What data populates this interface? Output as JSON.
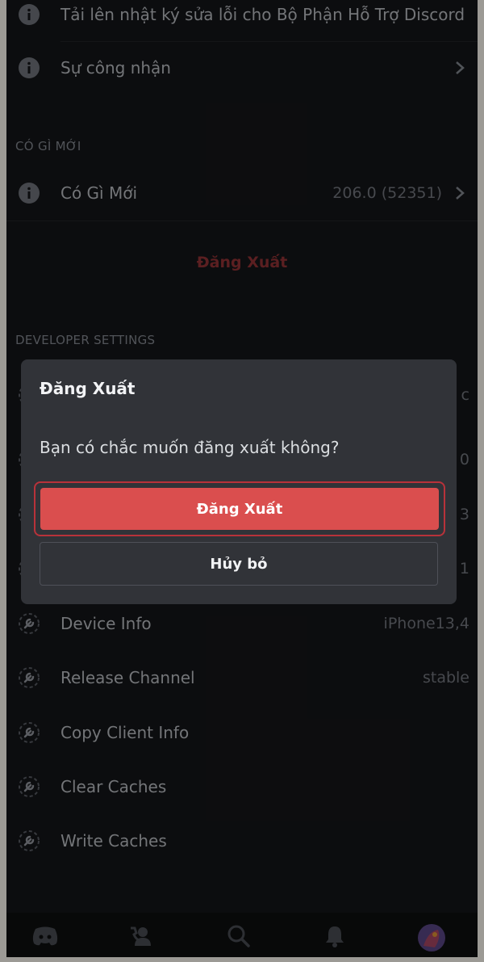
{
  "rows_top": [
    {
      "label": "Tải lên nhật ký sửa lỗi cho Bộ Phận Hỗ Trợ Discord",
      "icon": "info-icon"
    },
    {
      "label": "Sự công nhận",
      "icon": "info-icon"
    }
  ],
  "whats_new": {
    "section_title": "CÓ GÌ MỚI",
    "label": "Có Gì Mới",
    "value": "206.0 (52351)"
  },
  "logout_link": "Đăng Xuất",
  "developer": {
    "section_title": "DEVELOPER SETTINGS",
    "partial_values": [
      "c",
      "0",
      "3",
      "1"
    ],
    "rows": [
      {
        "label": "Device Info",
        "value": "iPhone13,4"
      },
      {
        "label": "Release Channel",
        "value": "stable"
      },
      {
        "label": "Copy Client Info",
        "value": ""
      },
      {
        "label": "Clear Caches",
        "value": ""
      },
      {
        "label": "Write Caches",
        "value": ""
      }
    ]
  },
  "dialog": {
    "title": "Đăng Xuất",
    "message": "Bạn có chắc muốn đăng xuất không?",
    "confirm_label": "Đăng Xuất",
    "cancel_label": "Hủy bỏ"
  },
  "tabbar": {
    "items": [
      "discord-home-icon",
      "friends-icon",
      "search-icon",
      "notifications-icon",
      "profile-avatar"
    ]
  },
  "colors": {
    "background": "#111214",
    "dialog": "#313338",
    "danger": "#da4e4e"
  }
}
